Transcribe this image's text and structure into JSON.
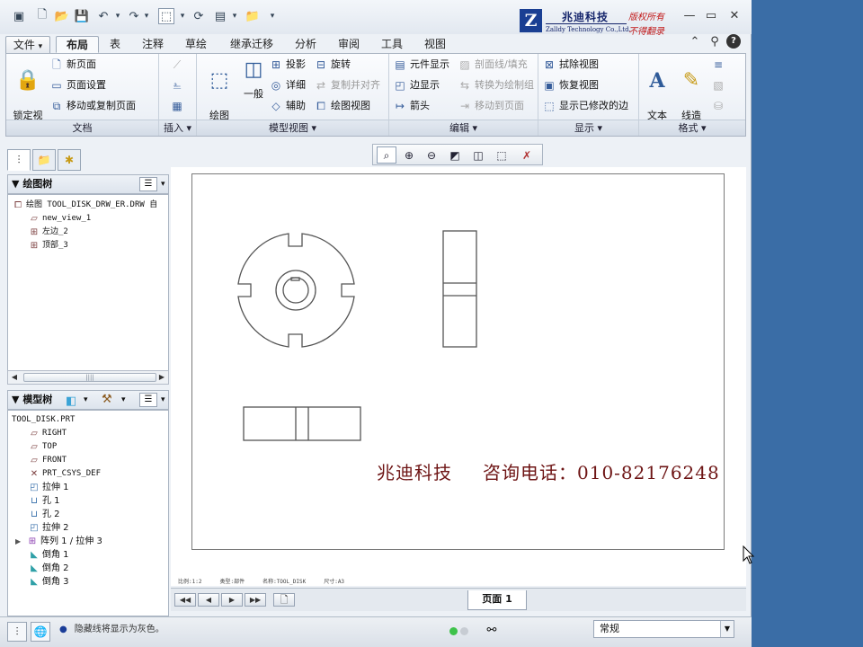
{
  "colors": {
    "desktop": "#3a6da6",
    "watermark": "#6e1515",
    "logo_blue": "#1a3f93",
    "logo_red": "#c21a1a"
  },
  "logo": {
    "mark": "Z",
    "cn_name": "兆迪科技",
    "en_name": "Zalldy Technology Co.,Ltd.",
    "right1": "版权所有",
    "right2": "不得翻录"
  },
  "window_controls": [
    "minimize-icon",
    "maximize-icon",
    "close-icon"
  ],
  "tabs": [
    {
      "label": "文件",
      "dropdown": "▾"
    },
    {
      "label": "布局",
      "active": true
    },
    {
      "label": "表"
    },
    {
      "label": "注释"
    },
    {
      "label": "草绘"
    },
    {
      "label": "继承迁移"
    },
    {
      "label": "分析"
    },
    {
      "label": "审阅"
    },
    {
      "label": "工具"
    },
    {
      "label": "视图"
    }
  ],
  "ribbon": {
    "doc": {
      "label": "文档",
      "lock_view": "锁定视\n图移动",
      "new_page": "新页面",
      "page_setup": "页面设置",
      "move_copy": "移动或复制页面"
    },
    "insert": {
      "label": "插入 ▾"
    },
    "model_view": {
      "label": "模型视图 ▾",
      "drawing_model": "绘图\n模型",
      "general": "一般",
      "projection": "投影",
      "detail": "详细",
      "auxiliary": "辅助",
      "revolve": "旋转",
      "copy_align": "复制并对齐",
      "drawing_view": "绘图视图"
    },
    "edit": {
      "label": "编辑 ▾",
      "element_display": "元件显示",
      "edge_display": "边显示",
      "arrow": "箭头",
      "section_line": "剖面线/填充",
      "convert_group": "转换为绘制组",
      "move_to_page": "移动到页面"
    },
    "display": {
      "label": "显示 ▾",
      "erase_view": "拭除视图",
      "restore_view": "恢复视图",
      "show_modified": "显示已修改的边"
    },
    "format": {
      "label": "格式 ▾",
      "text_style": "文本\n样式",
      "line_style": "线造\n型"
    }
  },
  "drawing_tree": {
    "title": "绘图树",
    "items": [
      {
        "label": "绘图 TOOL_DISK_DRW_ER.DRW 自",
        "level": 0,
        "icon": "drawing-icon"
      },
      {
        "label": "new_view_1",
        "level": 1,
        "icon": "view-icon"
      },
      {
        "label": "左边_2",
        "level": 1,
        "icon": "view-icon"
      },
      {
        "label": "顶部_3",
        "level": 1,
        "icon": "view-icon"
      }
    ],
    "scroll_thumb_text": "||||"
  },
  "model_tree": {
    "title": "模型树",
    "items": [
      {
        "label": "TOOL_DISK.PRT",
        "level": 0,
        "icon": ""
      },
      {
        "label": "RIGHT",
        "level": 1,
        "icon": "plane-icon"
      },
      {
        "label": "TOP",
        "level": 1,
        "icon": "plane-icon"
      },
      {
        "label": "FRONT",
        "level": 1,
        "icon": "plane-icon"
      },
      {
        "label": "PRT_CSYS_DEF",
        "level": 1,
        "icon": "csys-icon"
      },
      {
        "label": "拉伸 1",
        "level": 1,
        "icon": "extrude-icon"
      },
      {
        "label": "孔 1",
        "level": 1,
        "icon": "hole-icon"
      },
      {
        "label": "孔 2",
        "level": 1,
        "icon": "hole-icon"
      },
      {
        "label": "拉伸 2",
        "level": 1,
        "icon": "extrude-icon"
      },
      {
        "label": "阵列 1 / 拉伸 3",
        "level": 1,
        "icon": "pattern-icon",
        "expandable": true
      },
      {
        "label": "倒角 1",
        "level": 1,
        "icon": "chamfer-icon"
      },
      {
        "label": "倒角 2",
        "level": 1,
        "icon": "chamfer-icon"
      },
      {
        "label": "倒角 3",
        "level": 1,
        "icon": "chamfer-icon"
      }
    ]
  },
  "canvas": {
    "watermark_company": "兆迪科技",
    "watermark_phone": "咨询电话：010-82176248",
    "status_items": [
      "比例:1:2",
      "类型:部件",
      "名称:TOOL_DISK",
      "尺寸:A3"
    ]
  },
  "pages": {
    "tab_label": "页面 1",
    "nav": [
      "◀◀",
      "◀",
      "▶",
      "▶▶"
    ]
  },
  "status": {
    "message": "隐藏线将显示为灰色。",
    "bullet": "●",
    "filter": "常规"
  }
}
